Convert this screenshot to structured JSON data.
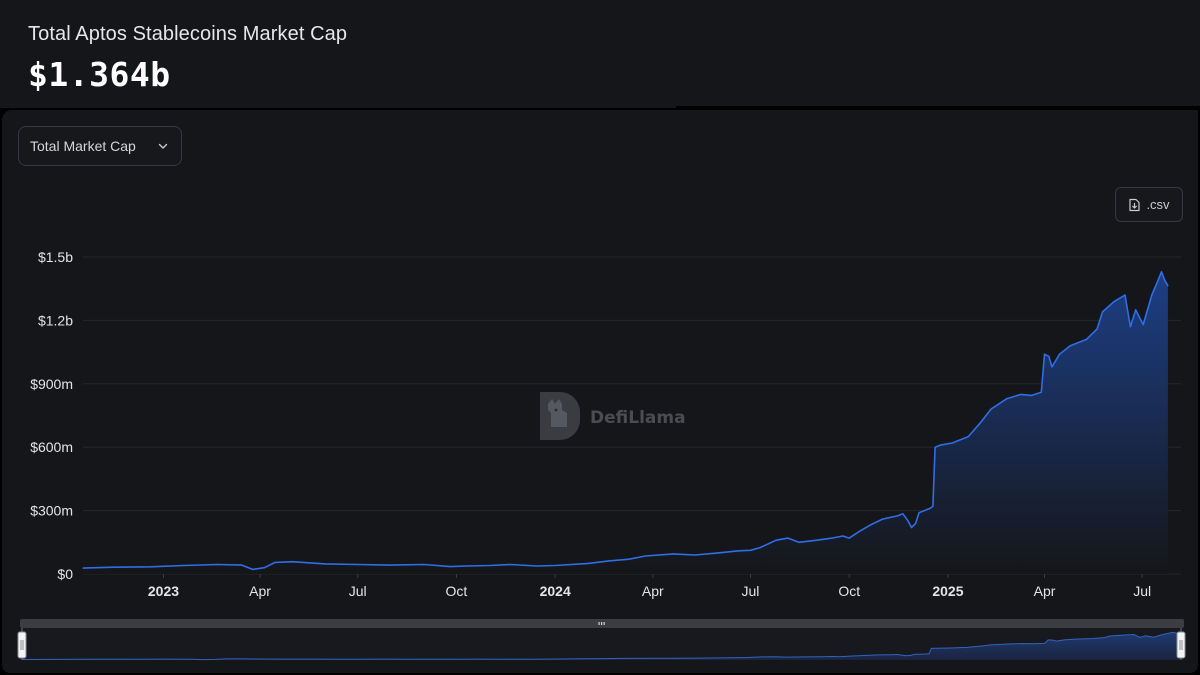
{
  "header": {
    "title": "Total Aptos Stablecoins Market Cap",
    "value": "$1.364b"
  },
  "controls": {
    "dropdown_label": "Total Market Cap",
    "csv_label": ".csv"
  },
  "watermark": {
    "text": "DefiLlama",
    "icon": "llama-logo-icon"
  },
  "colors": {
    "line": "#2f6ee5",
    "fill_top": "#1d3f86",
    "fill_bottom": "#151619",
    "panel": "#151619"
  },
  "chart_data": {
    "type": "area",
    "title": "",
    "xlabel": "",
    "ylabel": "",
    "ylim": [
      0,
      1500000000
    ],
    "y_ticks": [
      {
        "value": 0,
        "label": "$0"
      },
      {
        "value": 300000000,
        "label": "$300m"
      },
      {
        "value": 600000000,
        "label": "$600m"
      },
      {
        "value": 900000000,
        "label": "$900m"
      },
      {
        "value": 1200000000,
        "label": "$1.2b"
      },
      {
        "value": 1500000000,
        "label": "$1.5b"
      }
    ],
    "x_range": [
      "2022-10-18",
      "2025-07-26"
    ],
    "x_ticks": [
      {
        "date": "2023-01-01",
        "label": "2023",
        "bold": true
      },
      {
        "date": "2023-04-01",
        "label": "Apr",
        "bold": false
      },
      {
        "date": "2023-07-01",
        "label": "Jul",
        "bold": false
      },
      {
        "date": "2023-10-01",
        "label": "Oct",
        "bold": false
      },
      {
        "date": "2024-01-01",
        "label": "2024",
        "bold": true
      },
      {
        "date": "2024-04-01",
        "label": "Apr",
        "bold": false
      },
      {
        "date": "2024-07-01",
        "label": "Jul",
        "bold": false
      },
      {
        "date": "2024-10-01",
        "label": "Oct",
        "bold": false
      },
      {
        "date": "2025-01-01",
        "label": "2025",
        "bold": true
      },
      {
        "date": "2025-04-01",
        "label": "Apr",
        "bold": false
      },
      {
        "date": "2025-07-01",
        "label": "Jul",
        "bold": false
      }
    ],
    "grid": "horizontal",
    "legend": "none",
    "series": [
      {
        "points": [
          [
            "2022-10-18",
            28000000
          ],
          [
            "2022-11-15",
            32000000
          ],
          [
            "2022-12-20",
            34000000
          ],
          [
            "2023-01-20",
            40000000
          ],
          [
            "2023-02-20",
            45000000
          ],
          [
            "2023-03-15",
            42000000
          ],
          [
            "2023-03-25",
            22000000
          ],
          [
            "2023-04-05",
            30000000
          ],
          [
            "2023-04-15",
            55000000
          ],
          [
            "2023-05-01",
            58000000
          ],
          [
            "2023-06-01",
            48000000
          ],
          [
            "2023-07-01",
            45000000
          ],
          [
            "2023-08-01",
            42000000
          ],
          [
            "2023-09-01",
            45000000
          ],
          [
            "2023-09-25",
            35000000
          ],
          [
            "2023-10-10",
            38000000
          ],
          [
            "2023-11-01",
            40000000
          ],
          [
            "2023-11-20",
            45000000
          ],
          [
            "2023-12-15",
            38000000
          ],
          [
            "2024-01-01",
            40000000
          ],
          [
            "2024-02-01",
            50000000
          ],
          [
            "2024-02-20",
            62000000
          ],
          [
            "2024-03-10",
            70000000
          ],
          [
            "2024-03-25",
            85000000
          ],
          [
            "2024-04-20",
            95000000
          ],
          [
            "2024-05-10",
            90000000
          ],
          [
            "2024-06-01",
            100000000
          ],
          [
            "2024-06-20",
            110000000
          ],
          [
            "2024-07-01",
            112000000
          ],
          [
            "2024-07-10",
            125000000
          ],
          [
            "2024-07-25",
            160000000
          ],
          [
            "2024-08-05",
            170000000
          ],
          [
            "2024-08-15",
            150000000
          ],
          [
            "2024-09-01",
            160000000
          ],
          [
            "2024-09-15",
            170000000
          ],
          [
            "2024-09-25",
            180000000
          ],
          [
            "2024-10-01",
            170000000
          ],
          [
            "2024-10-10",
            200000000
          ],
          [
            "2024-10-20",
            230000000
          ],
          [
            "2024-11-01",
            260000000
          ],
          [
            "2024-11-15",
            275000000
          ],
          [
            "2024-11-20",
            285000000
          ],
          [
            "2024-11-25",
            250000000
          ],
          [
            "2024-11-28",
            220000000
          ],
          [
            "2024-12-02",
            240000000
          ],
          [
            "2024-12-05",
            290000000
          ],
          [
            "2024-12-15",
            310000000
          ],
          [
            "2024-12-18",
            320000000
          ],
          [
            "2024-12-20",
            600000000
          ],
          [
            "2024-12-25",
            610000000
          ],
          [
            "2025-01-05",
            620000000
          ],
          [
            "2025-01-20",
            650000000
          ],
          [
            "2025-02-01",
            720000000
          ],
          [
            "2025-02-10",
            780000000
          ],
          [
            "2025-02-25",
            830000000
          ],
          [
            "2025-03-10",
            850000000
          ],
          [
            "2025-03-20",
            845000000
          ],
          [
            "2025-03-29",
            860000000
          ],
          [
            "2025-04-01",
            1040000000
          ],
          [
            "2025-04-05",
            1030000000
          ],
          [
            "2025-04-08",
            980000000
          ],
          [
            "2025-04-15",
            1040000000
          ],
          [
            "2025-04-25",
            1080000000
          ],
          [
            "2025-05-10",
            1110000000
          ],
          [
            "2025-05-20",
            1160000000
          ],
          [
            "2025-05-25",
            1240000000
          ],
          [
            "2025-06-05",
            1290000000
          ],
          [
            "2025-06-15",
            1320000000
          ],
          [
            "2025-06-20",
            1170000000
          ],
          [
            "2025-06-25",
            1250000000
          ],
          [
            "2025-07-02",
            1180000000
          ],
          [
            "2025-07-10",
            1320000000
          ],
          [
            "2025-07-15",
            1380000000
          ],
          [
            "2025-07-19",
            1430000000
          ],
          [
            "2025-07-22",
            1390000000
          ],
          [
            "2025-07-25",
            1364000000
          ]
        ]
      }
    ]
  }
}
